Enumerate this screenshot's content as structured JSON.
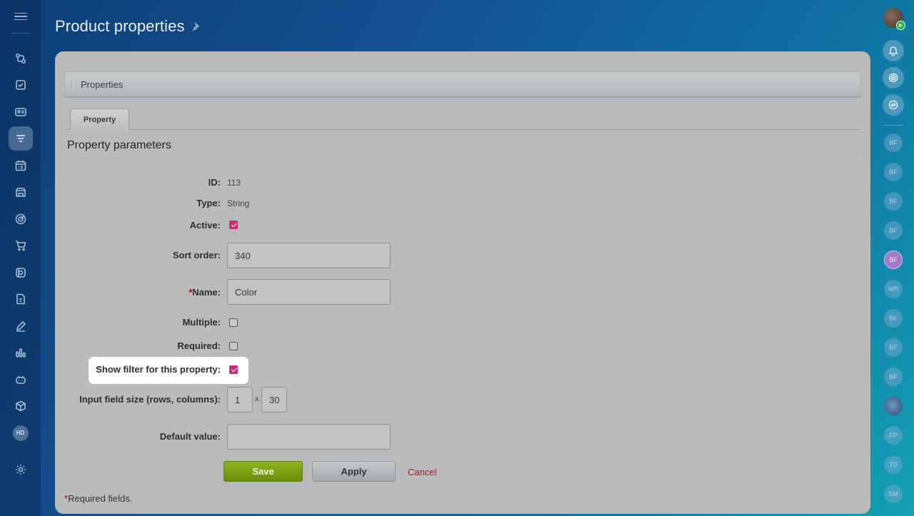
{
  "page": {
    "title": "Product properties"
  },
  "left_sidebar": {
    "items": [
      {
        "icon": "workflow-icon"
      },
      {
        "icon": "tasks-checkbox-icon"
      },
      {
        "icon": "contact-card-icon"
      },
      {
        "icon": "funnel-filter-icon",
        "active": true
      },
      {
        "icon": "calendar-list-icon"
      },
      {
        "icon": "store-icon"
      },
      {
        "icon": "target-icon"
      },
      {
        "icon": "cart-icon"
      },
      {
        "icon": "automation-icon"
      },
      {
        "icon": "document-edit-icon"
      },
      {
        "icon": "pen-sign-icon"
      },
      {
        "icon": "analytics-bars-icon"
      },
      {
        "icon": "robot-icon"
      },
      {
        "icon": "box-icon"
      }
    ],
    "hd_badge": "HD"
  },
  "right_sidebar": {
    "contacts": [
      "BF",
      "BF",
      "BF",
      "BF",
      "BF",
      "WR",
      "BF",
      "BF",
      "BF",
      "",
      "FP",
      "TD",
      "SM"
    ]
  },
  "section": {
    "title": "Properties"
  },
  "tabs": [
    {
      "label": "Property",
      "active": true
    }
  ],
  "form": {
    "title": "Property parameters",
    "id_label": "ID:",
    "id_value": "113",
    "type_label": "Type:",
    "type_value": "String",
    "active_label": "Active:",
    "active_checked": true,
    "sort_label": "Sort order:",
    "sort_value": "340",
    "name_required_mark": "*",
    "name_label": "Name:",
    "name_value": "Color",
    "multiple_label": "Multiple:",
    "multiple_checked": false,
    "required_label": "Required:",
    "required_checked": false,
    "show_filter_label": "Show filter for this property:",
    "show_filter_checked": true,
    "size_label": "Input field size (rows, columns):",
    "size_rows": "1",
    "size_sep": "x",
    "size_cols": "30",
    "default_label": "Default value:",
    "default_value": ""
  },
  "actions": {
    "save": "Save",
    "apply": "Apply",
    "cancel": "Cancel"
  },
  "footer": {
    "required_mark": "*",
    "required_note": "Required fields."
  },
  "colors": {
    "accent_checkbox": "#c72e7b",
    "save_button": "#7a9b14",
    "cancel_link": "#9c1f1f"
  }
}
